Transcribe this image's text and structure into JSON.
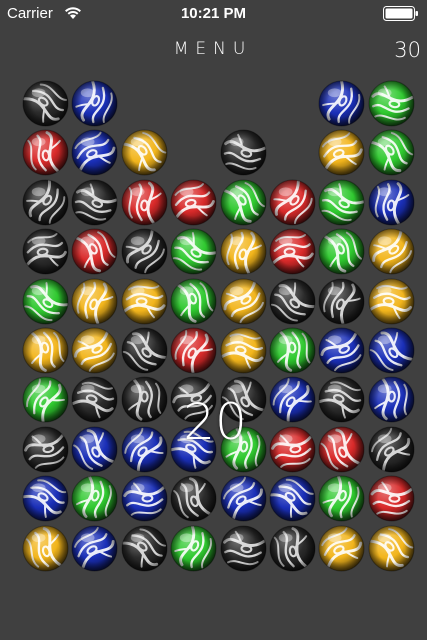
{
  "status_bar": {
    "carrier": "Carrier",
    "time": "10:21 PM",
    "wifi_icon": "wifi-icon",
    "battery_icon": "battery-full-icon"
  },
  "header": {
    "menu_label": "MENU",
    "score": "30"
  },
  "popup_points": "20",
  "colors": {
    "background": "#404040",
    "black": "#2b2b2b",
    "blue": "#1a2fb8",
    "red": "#d92a2a",
    "yellow": "#f2b51c",
    "green": "#2fc92f"
  },
  "board": {
    "columns": 8,
    "rows": 10,
    "grid": [
      [
        "black",
        "blue",
        null,
        null,
        null,
        null,
        "blue",
        "green"
      ],
      [
        "red",
        "blue",
        "yellow",
        null,
        "black",
        null,
        "yellow",
        "green"
      ],
      [
        "black",
        "black",
        "red",
        "red",
        "green",
        "red",
        "green",
        "blue"
      ],
      [
        "black",
        "red",
        "black",
        "green",
        "yellow",
        "red",
        "green",
        "yellow"
      ],
      [
        "green",
        "yellow",
        "yellow",
        "green",
        "yellow",
        "black",
        "black",
        "yellow"
      ],
      [
        "yellow",
        "yellow",
        "black",
        "red",
        "yellow",
        "green",
        "blue",
        "blue"
      ],
      [
        "green",
        "black",
        "black",
        "black",
        "black",
        "blue",
        "black",
        "blue"
      ],
      [
        "black",
        "blue",
        "blue",
        "blue",
        "green",
        "red",
        "red",
        "black"
      ],
      [
        "blue",
        "green",
        "blue",
        "black",
        "blue",
        "blue",
        "green",
        "red"
      ],
      [
        "yellow",
        "blue",
        "black",
        "green",
        "black",
        "black",
        "yellow",
        "yellow"
      ]
    ]
  }
}
